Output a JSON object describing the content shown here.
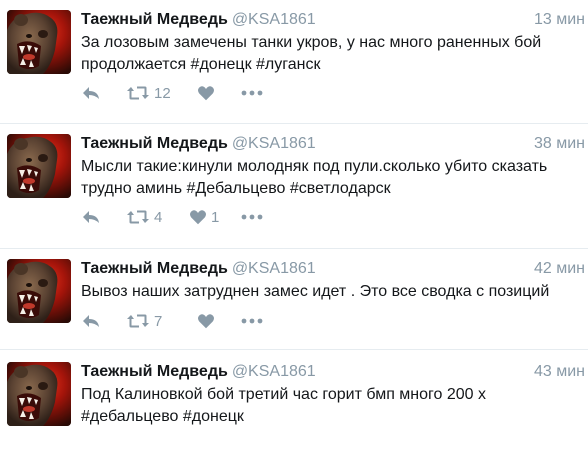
{
  "tweets": [
    {
      "name": "Таежный Медведь",
      "handle": "@KSA1861",
      "time": "13 мин",
      "text": "За лозовым замечены танки укров, у нас много раненных бой продолжается #донецк #луганск",
      "retweets": "12",
      "likes": ""
    },
    {
      "name": "Таежный Медведь",
      "handle": "@KSA1861",
      "time": "38 мин",
      "text": "Мысли такие:кинули молодняк под пули.сколько убито сказать трудно аминь #Дебальцево #светлодарск",
      "retweets": "4",
      "likes": "1"
    },
    {
      "name": "Таежный Медведь",
      "handle": "@KSA1861",
      "time": "42 мин",
      "text": "Вывоз наших затруднен замес идет . Это все сводка с позиций",
      "retweets": "7",
      "likes": ""
    },
    {
      "name": "Таежный Медведь",
      "handle": "@KSA1861",
      "time": "43 мин",
      "text": "Под Калиновкой бой третий час горит бмп много 200 х #дебальцево #донецк",
      "retweets": "",
      "likes": ""
    }
  ],
  "icons": {
    "reply": "reply-icon",
    "retweet": "retweet-icon",
    "like": "heart-icon",
    "more": "more-icon"
  },
  "colors": {
    "muted": "#8899a6",
    "text": "#14171a",
    "divider": "#e6ecf0",
    "avatar_red": "#d11a0e"
  }
}
